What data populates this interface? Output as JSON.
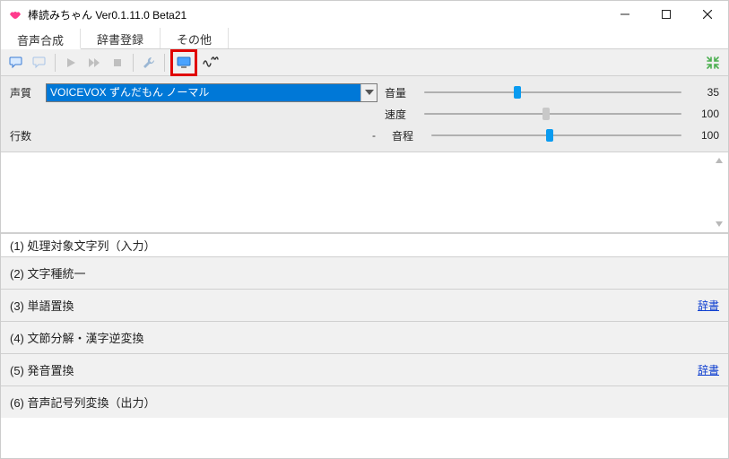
{
  "window": {
    "title": "棒読みちゃん Ver0.1.11.0 Beta21"
  },
  "tabs": {
    "items": [
      {
        "label": "音声合成",
        "active": true
      },
      {
        "label": "辞書登録",
        "active": false
      },
      {
        "label": "その他",
        "active": false
      }
    ]
  },
  "controls": {
    "voice_label": "声質",
    "voice_value": "VOICEVOX ずんだもん ノーマル",
    "volume_label": "音量",
    "volume_value": "35",
    "speed_label": "速度",
    "speed_value": "100",
    "lines_label": "行数",
    "lines_value": "-",
    "pitch_label": "音程",
    "pitch_value": "100"
  },
  "sections": {
    "s1": "(1) 処理対象文字列（入力）",
    "s2": "(2) 文字種統一",
    "s3": "(3) 単語置換",
    "s4": "(4) 文節分解・漢字逆変換",
    "s5": "(5) 発音置換",
    "s6": "(6) 音声記号列変換（出力）",
    "dict_link": "辞書"
  },
  "icons": {
    "app": "lips-icon",
    "balloon1": "speech-balloon-icon",
    "balloon2": "speech-balloon-dim-icon",
    "play": "play-icon",
    "ff": "fast-forward-icon",
    "stop": "stop-icon",
    "wrench": "wrench-icon",
    "monitor": "monitor-icon",
    "pulse": "pulse-icon",
    "compress": "compress-icon"
  }
}
